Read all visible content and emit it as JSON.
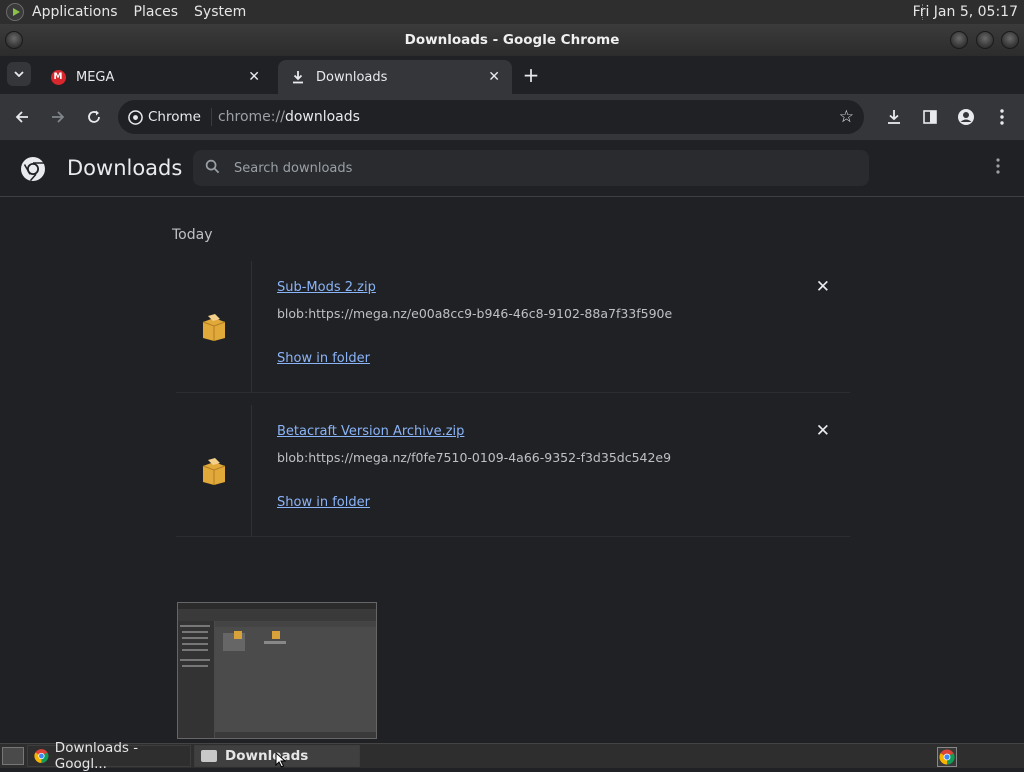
{
  "panel": {
    "menus": [
      "Applications",
      "Places",
      "System"
    ],
    "clock": "Fri Jan  5, 05:17"
  },
  "window": {
    "title": "Downloads - Google Chrome"
  },
  "tabs": [
    {
      "label": "MEGA",
      "icon": "mega-icon"
    },
    {
      "label": "Downloads",
      "icon": "download-icon"
    }
  ],
  "toolbar": {
    "site_chip": "Chrome",
    "url_scheme": "chrome://",
    "url_path": "downloads"
  },
  "page": {
    "title": "Downloads",
    "search_placeholder": "Search downloads",
    "section": "Today",
    "downloads": [
      {
        "name": "Sub-Mods 2.zip",
        "url": "blob:https://mega.nz/e00a8cc9-b946-46c8-9102-88a7f33f590e",
        "action": "Show in folder"
      },
      {
        "name": "Betacraft Version Archive.zip",
        "url": "blob:https://mega.nz/f0fe7510-0109-4a66-9352-f3d35dc542e9",
        "action": "Show in folder"
      }
    ]
  },
  "taskbar": {
    "items": [
      "Downloads - Googl...",
      "Downloads"
    ]
  },
  "colors": {
    "background": "#202124",
    "toolbar": "#35363a",
    "link": "#8ab4f8",
    "mega_red": "#d9272e"
  }
}
